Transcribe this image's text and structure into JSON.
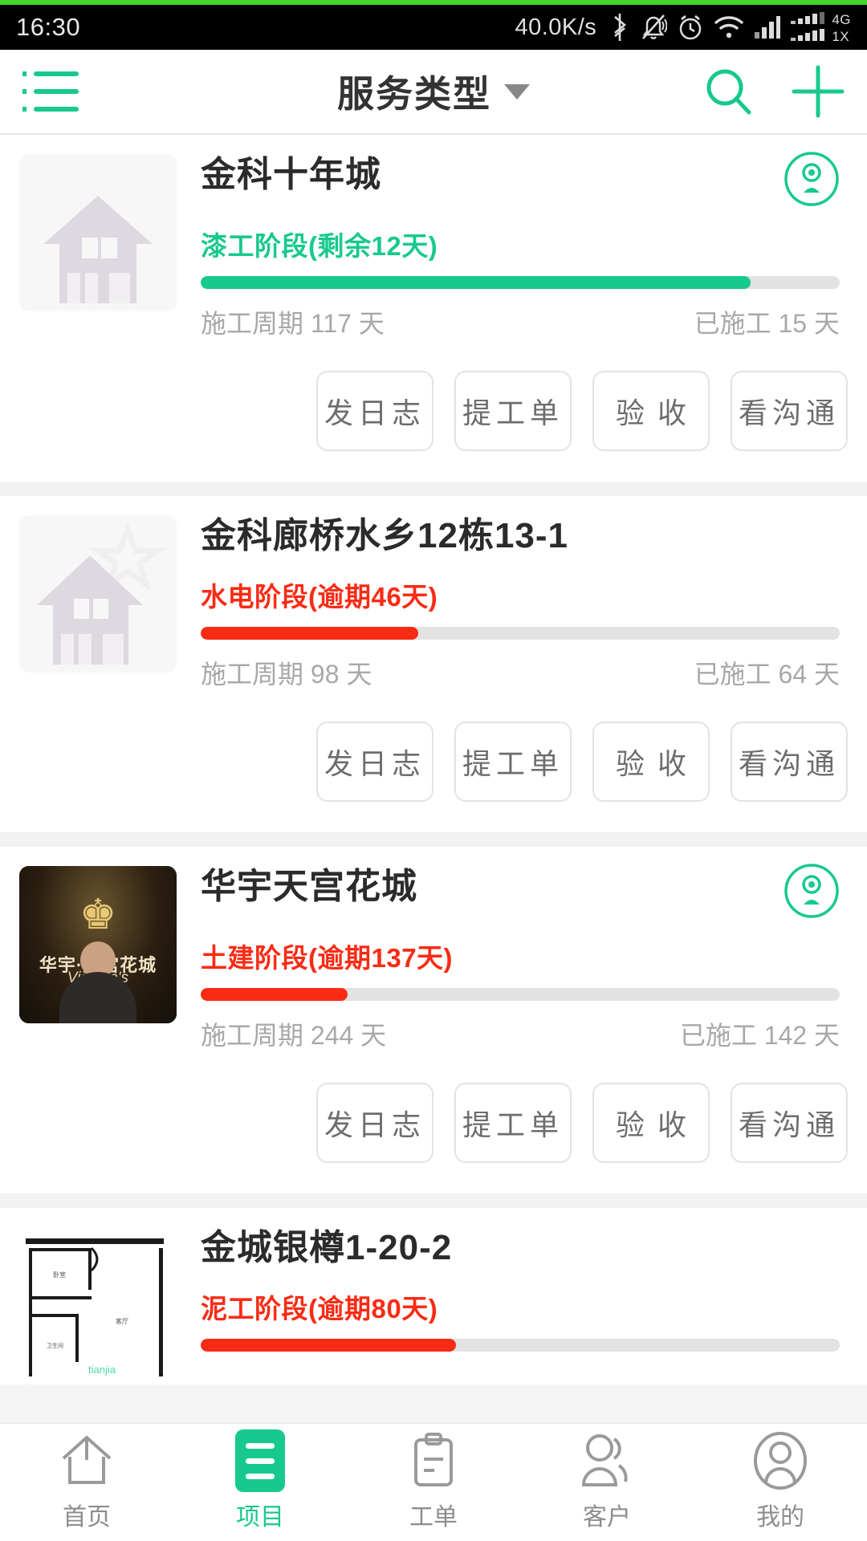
{
  "status_bar": {
    "time": "16:30",
    "net_speed": "40.0K/s",
    "icons": [
      "bluetooth-icon",
      "mute-icon",
      "alarm-icon",
      "wifi-icon",
      "signal-icon",
      "signal-dual-icon"
    ],
    "network_label_top": "4G",
    "network_label_bottom": "1X",
    "accent_color": "#44d62c"
  },
  "header": {
    "menu_icon": "list-menu-icon",
    "title": "服务类型",
    "dropdown_icon": "chevron-down-icon",
    "search_icon": "search-icon",
    "add_icon": "plus-icon",
    "accent_color": "#17c98e"
  },
  "actions": {
    "log": "发日志",
    "work_order": "提工单",
    "acceptance": "验收",
    "communication": "看沟通"
  },
  "labels": {
    "cycle_prefix": "施工周期",
    "done_prefix": "已施工",
    "day_unit": "天"
  },
  "colors": {
    "green": "#17c98e",
    "red": "#fa2b15",
    "track": "#e2e2e2"
  },
  "cards": [
    {
      "title": "金科十年城",
      "status": "漆工阶段(剩余12天)",
      "status_color": "#17c98e",
      "progress_pct": 86,
      "progress_color": "#17c98e",
      "cycle": "施工周期 117 天",
      "done": "已施工 15 天",
      "cycle_days": 117,
      "done_days": 15,
      "has_avatar": true,
      "thumb": "house-placeholder-icon"
    },
    {
      "title": "金科廊桥水乡12栋13-1",
      "status": "水电阶段(逾期46天)",
      "status_color": "#fa2b15",
      "progress_pct": 34,
      "progress_color": "#fa2b15",
      "cycle": "施工周期 98 天",
      "done": "已施工 64 天",
      "cycle_days": 98,
      "done_days": 64,
      "has_avatar": false,
      "thumb": "house-star-placeholder-icon"
    },
    {
      "title": "华宇天宫花城",
      "status": "土建阶段(逾期137天)",
      "status_color": "#fa2b15",
      "progress_pct": 23,
      "progress_color": "#fa2b15",
      "cycle": "施工周期 244 天",
      "done": "已施工 142 天",
      "cycle_days": 244,
      "done_days": 142,
      "has_avatar": true,
      "thumb": "victorias-photo",
      "thumb_brand": "华宇·天宫花城",
      "thumb_script": "Victoria's"
    },
    {
      "title": "金城银樽1-20-2",
      "status": "泥工阶段(逾期80天)",
      "status_color": "#fa2b15",
      "progress_pct": 40,
      "progress_color": "#fa2b15",
      "cycle": "",
      "done": "",
      "has_avatar": false,
      "thumb": "floorplan-photo"
    }
  ],
  "tabbar": {
    "items": [
      {
        "label": "首页",
        "icon": "home-icon",
        "active": false
      },
      {
        "label": "项目",
        "icon": "project-list-icon",
        "active": true
      },
      {
        "label": "工单",
        "icon": "clipboard-icon",
        "active": false
      },
      {
        "label": "客户",
        "icon": "users-icon",
        "active": false
      },
      {
        "label": "我的",
        "icon": "person-circle-icon",
        "active": false
      }
    ]
  }
}
